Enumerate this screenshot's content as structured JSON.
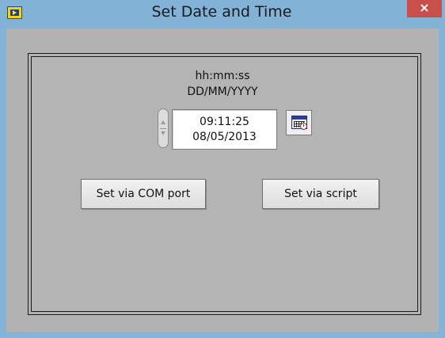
{
  "window": {
    "title": "Set Date and Time",
    "close_glyph": "×",
    "app_icon": "labview-app-icon",
    "colors": {
      "titlebar": "#83b2d7",
      "close": "#c7504a",
      "panel": "#b4b4b4"
    }
  },
  "format": {
    "time_format": "hh:mm:ss",
    "date_format": "DD/MM/YYYY"
  },
  "datetime": {
    "time": "09:11:25",
    "date": "08/05/2013"
  },
  "icons": {
    "spinner": "up-down-spinner-icon",
    "calendar": "calendar-clock-icon"
  },
  "buttons": {
    "set_com": "Set via COM port",
    "set_script": "Set via script"
  }
}
